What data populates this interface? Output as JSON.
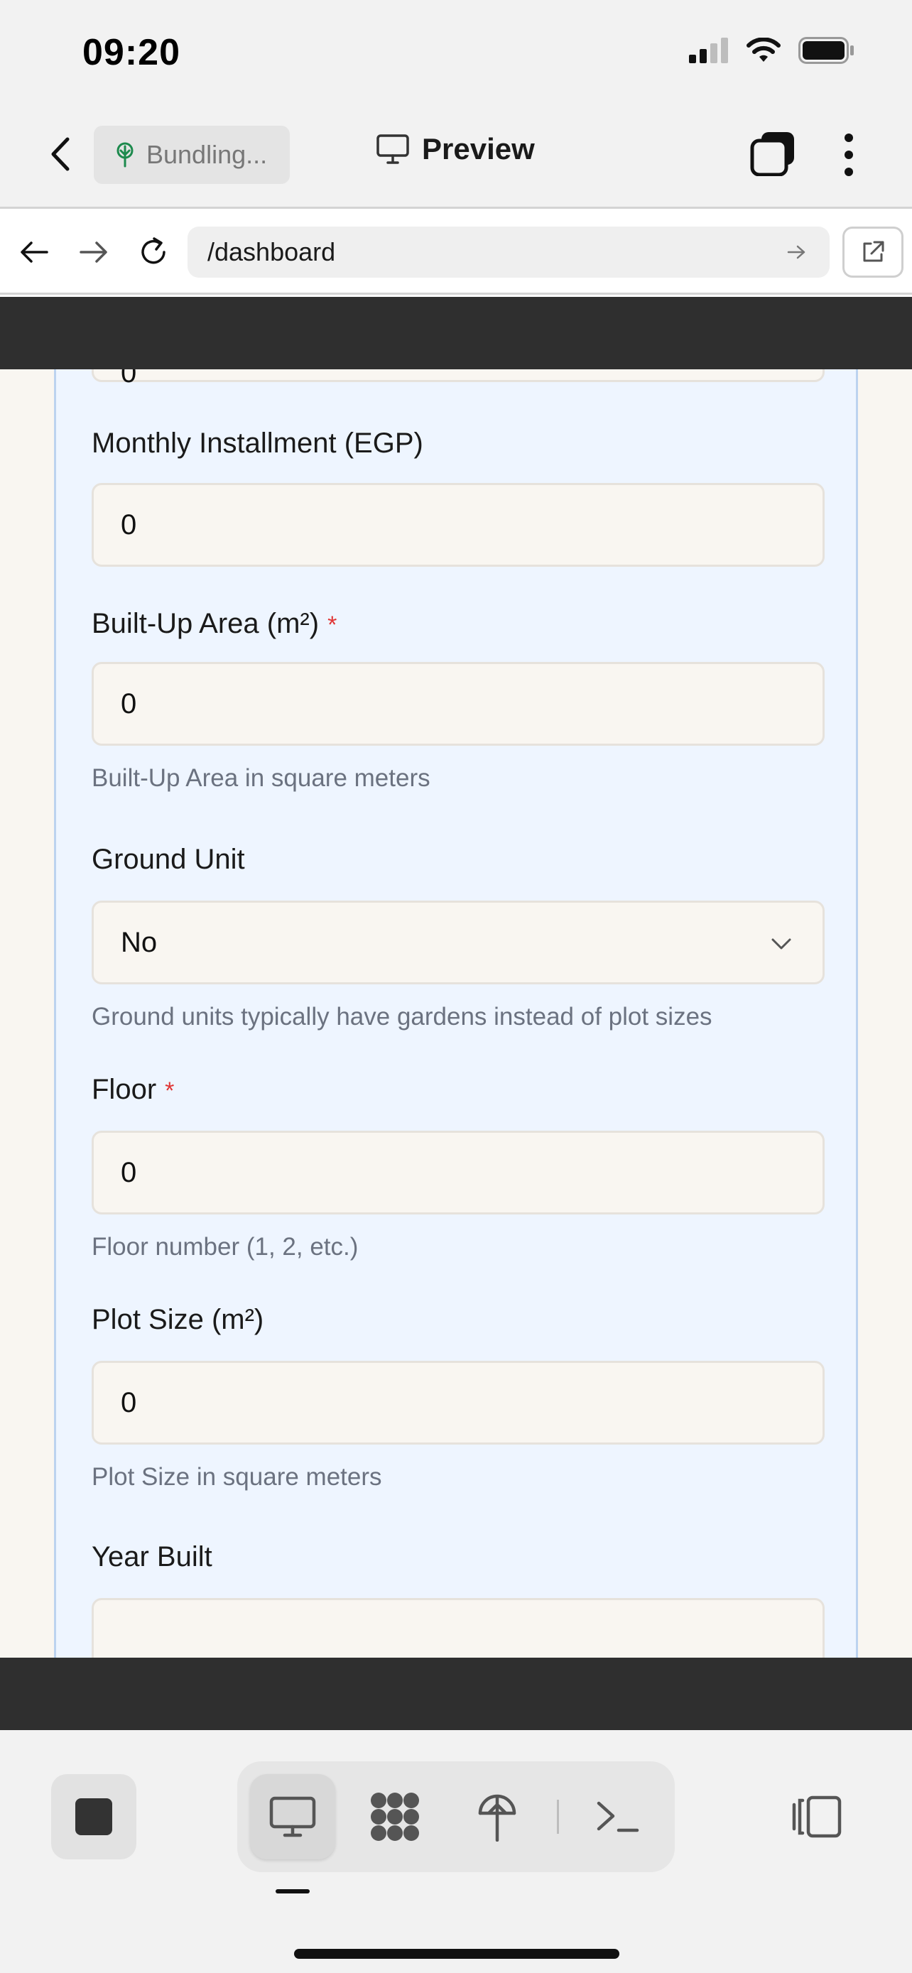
{
  "status_bar": {
    "time": "09:20"
  },
  "header": {
    "back_icon": "chevron-left-icon",
    "project_chip": "Bundling...",
    "project_icon": "tree-icon",
    "title": "Preview",
    "title_icon": "monitor-icon",
    "tabs_icon": "tabs-icon",
    "more_icon": "more-vertical-icon"
  },
  "url_bar": {
    "path": "/dashboard",
    "go_icon": "arrow-right-icon",
    "external_icon": "external-link-icon"
  },
  "form": {
    "prev_value": "0",
    "monthly_installment": {
      "label": "Monthly Installment (EGP)",
      "value": "0"
    },
    "built_up_area": {
      "label": "Built-Up Area (m²)",
      "required": "*",
      "value": "0",
      "helper": "Built-Up Area in square meters"
    },
    "ground_unit": {
      "label": "Ground Unit",
      "value": "No",
      "helper": "Ground units typically have gardens instead of plot sizes"
    },
    "floor": {
      "label": "Floor",
      "required": "*",
      "value": "0",
      "helper": "Floor number (1, 2, etc.)"
    },
    "plot_size": {
      "label": "Plot Size (m²)",
      "value": "0",
      "helper": "Plot Size in square meters"
    },
    "year_built": {
      "label": "Year Built",
      "value": ""
    }
  },
  "toolbar": {
    "items": [
      "monitor-icon",
      "grid-blob-icon",
      "antenna-icon",
      "terminal-icon"
    ],
    "active_index": 0
  },
  "colors": {
    "required": "#e03535",
    "card_bg": "#eef5ff",
    "input_bg": "#f9f6f1",
    "dark_frame": "#2f2f2f"
  }
}
